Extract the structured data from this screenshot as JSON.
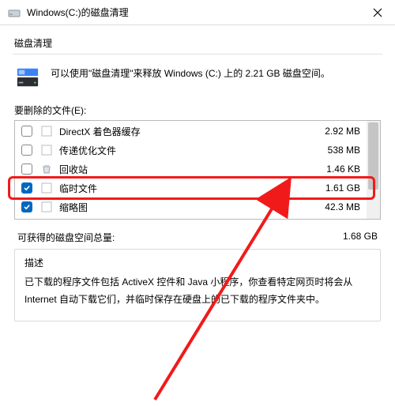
{
  "window": {
    "title": "Windows(C:)的磁盘清理"
  },
  "tab": "磁盘清理",
  "intro": "可以使用\"磁盘清理\"来释放 Windows (C:) 上的 2.21 GB 磁盘空间。",
  "section_label": "要删除的文件(E):",
  "items": [
    {
      "label": "DirectX 着色器缓存",
      "size": "2.92 MB",
      "checked": false
    },
    {
      "label": "传递优化文件",
      "size": "538 MB",
      "checked": false
    },
    {
      "label": "回收站",
      "size": "1.46 KB",
      "checked": false
    },
    {
      "label": "临时文件",
      "size": "1.61 GB",
      "checked": true
    },
    {
      "label": "缩略图",
      "size": "42.3 MB",
      "checked": true
    }
  ],
  "total": {
    "label": "可获得的磁盘空间总量:",
    "value": "1.68 GB"
  },
  "desc_title": "描述",
  "desc_body": "已下载的程序文件包括 ActiveX 控件和 Java 小程序，你查看特定网页时将会从 Internet 自动下载它们，并临时保存在硬盘上的已下载的程序文件夹中。"
}
